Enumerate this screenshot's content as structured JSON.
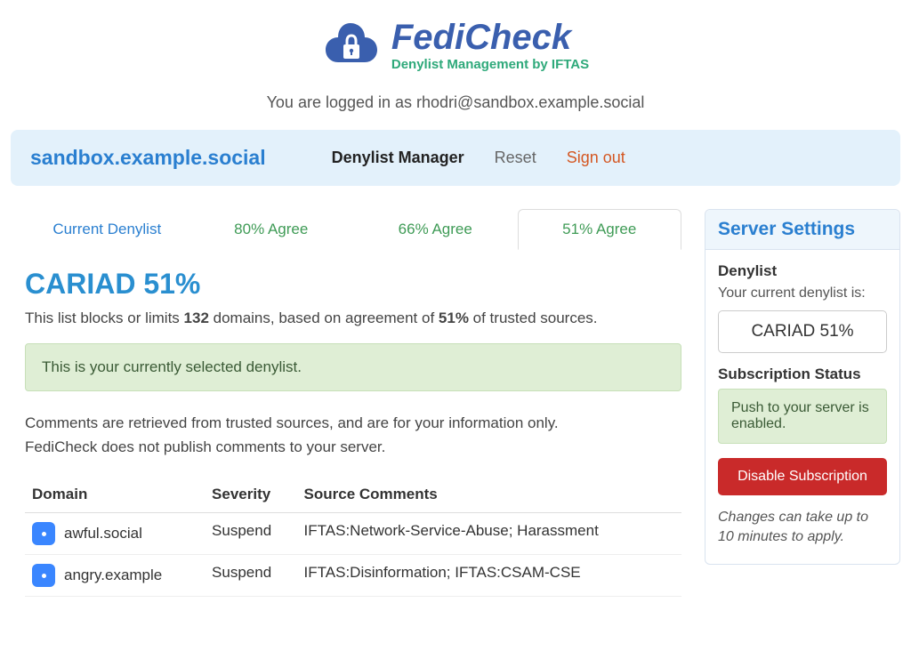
{
  "brand": {
    "title": "FediCheck",
    "tagline": "Denylist Management by IFTAS"
  },
  "login": {
    "prefix": "You are logged in as ",
    "email": "rhodri@sandbox.example.social"
  },
  "topbar": {
    "server": "sandbox.example.social",
    "denylist_manager": "Denylist Manager",
    "reset": "Reset",
    "signout": "Sign out"
  },
  "tabs": {
    "current": "Current Denylist",
    "agree80": "80% Agree",
    "agree66": "66% Agree",
    "agree51": "51% Agree"
  },
  "main": {
    "title": "CARIAD 51%",
    "desc_pre": "This list blocks or limits ",
    "desc_count": "132",
    "desc_mid": " domains, based on agreement of ",
    "desc_pct": "51%",
    "desc_post": " of trusted sources.",
    "selected_alert": "This is your currently selected denylist.",
    "notes_line1": "Comments are retrieved from trusted sources, and are for your information only.",
    "notes_line2": "FediCheck does not publish comments to your server.",
    "table": {
      "col_domain": "Domain",
      "col_severity": "Severity",
      "col_comments": "Source Comments",
      "rows": [
        {
          "domain": "awful.social",
          "severity": "Suspend",
          "comments": "IFTAS:Network-Service-Abuse; Harassment"
        },
        {
          "domain": "angry.example",
          "severity": "Suspend",
          "comments": "IFTAS:Disinformation; IFTAS:CSAM-CSE"
        }
      ]
    }
  },
  "side": {
    "heading": "Server Settings",
    "denylist_label": "Denylist",
    "denylist_sub": "Your current denylist is:",
    "denylist_value": "CARIAD 51%",
    "sub_status_label": "Subscription Status",
    "sub_status_msg": "Push to your server is enabled.",
    "disable_btn": "Disable Subscription",
    "hint": "Changes can take up to 10 minutes to apply."
  }
}
